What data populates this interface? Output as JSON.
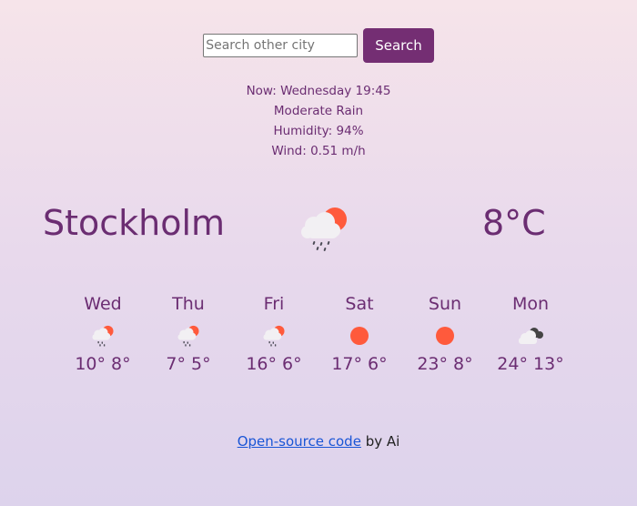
{
  "search": {
    "placeholder": "Search other city",
    "value": "",
    "button_label": "Search"
  },
  "current": {
    "now": "Now: Wednesday 19:45",
    "condition": "Moderate Rain",
    "humidity": "Humidity: 94%",
    "wind": "Wind: 0.51 m/h",
    "city": "Stockholm",
    "temperature": "8°C",
    "icon": "sun-behind-rain-cloud-icon"
  },
  "forecast": [
    {
      "day": "Wed",
      "temps": "10° 8°",
      "icon": "sun-behind-rain-cloud-icon"
    },
    {
      "day": "Thu",
      "temps": "7° 5°",
      "icon": "sun-behind-rain-cloud-icon"
    },
    {
      "day": "Fri",
      "temps": "16° 6°",
      "icon": "sun-behind-rain-cloud-icon"
    },
    {
      "day": "Sat",
      "temps": "17° 6°",
      "icon": "sun-icon"
    },
    {
      "day": "Sun",
      "temps": "23° 8°",
      "icon": "sun-icon"
    },
    {
      "day": "Mon",
      "temps": "24° 13°",
      "icon": "clouds-icon"
    }
  ],
  "footer": {
    "link_text": "Open-source code",
    "suffix": " by Ai"
  },
  "colors": {
    "accent": "#742e73",
    "text": "#6b2d72",
    "sun": "#ff5a3c",
    "link": "#1a55d6"
  }
}
